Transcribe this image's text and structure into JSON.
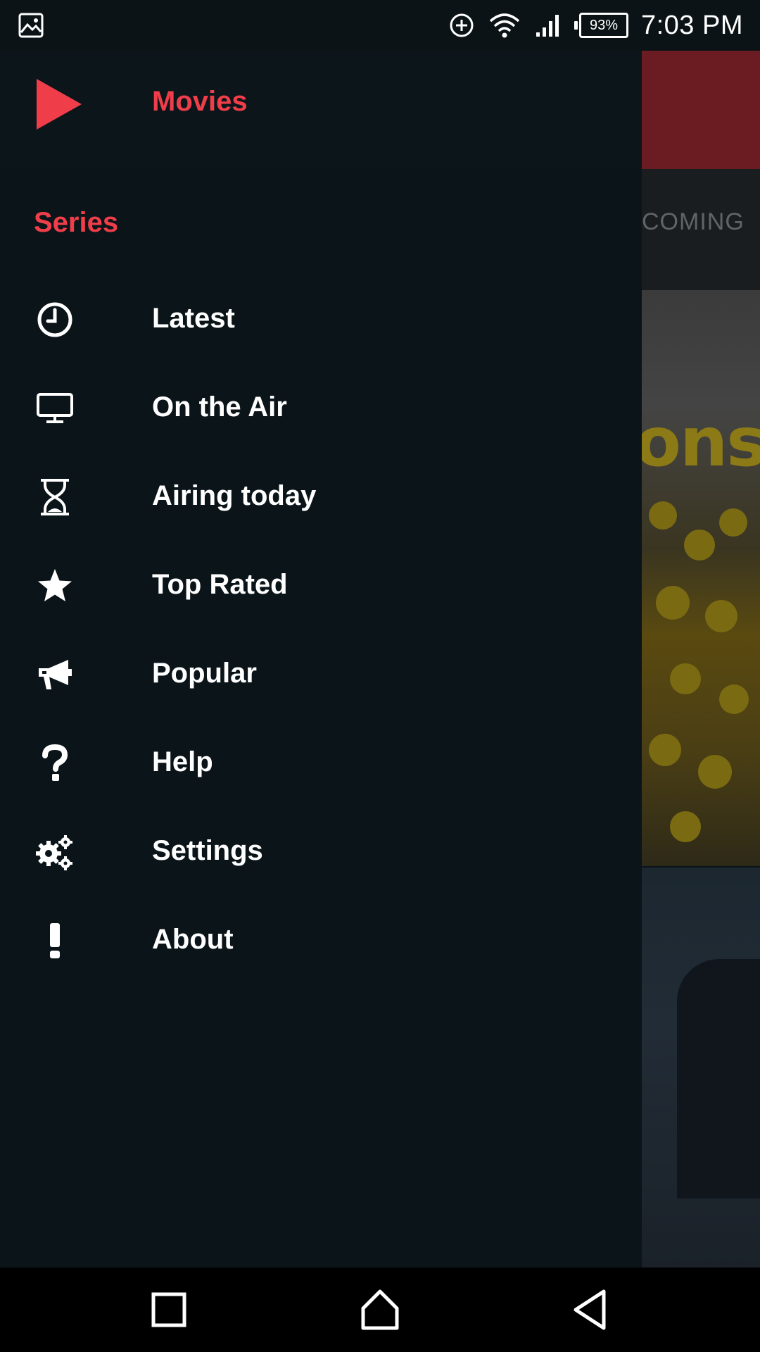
{
  "status_bar": {
    "time": "7:03 PM",
    "battery_percent": "93%",
    "icons": [
      "image-icon",
      "data-saver-icon",
      "wifi-icon",
      "cell-signal-icon",
      "battery-icon"
    ]
  },
  "background_app": {
    "tab_label": "COMING",
    "poster_text": "ons",
    "toolbar_color": "#6b1c22"
  },
  "drawer": {
    "header": {
      "title": "Movies",
      "icon": "play-icon",
      "accent": "#ef3e4a"
    },
    "section_label": "Series",
    "items": [
      {
        "label": "Latest",
        "icon": "clock-icon"
      },
      {
        "label": "On the Air",
        "icon": "monitor-icon"
      },
      {
        "label": "Airing today",
        "icon": "hourglass-icon"
      },
      {
        "label": "Top Rated",
        "icon": "star-icon"
      },
      {
        "label": "Popular",
        "icon": "megaphone-icon"
      },
      {
        "label": "Help",
        "icon": "question-icon"
      },
      {
        "label": "Settings",
        "icon": "gears-icon"
      },
      {
        "label": "About",
        "icon": "exclamation-icon"
      }
    ]
  },
  "nav_bar": {
    "buttons": [
      "recents-button",
      "home-button",
      "back-button"
    ]
  },
  "colors": {
    "drawer_bg": "#0b1519",
    "accent": "#ef3e4a",
    "text": "#ffffff"
  }
}
